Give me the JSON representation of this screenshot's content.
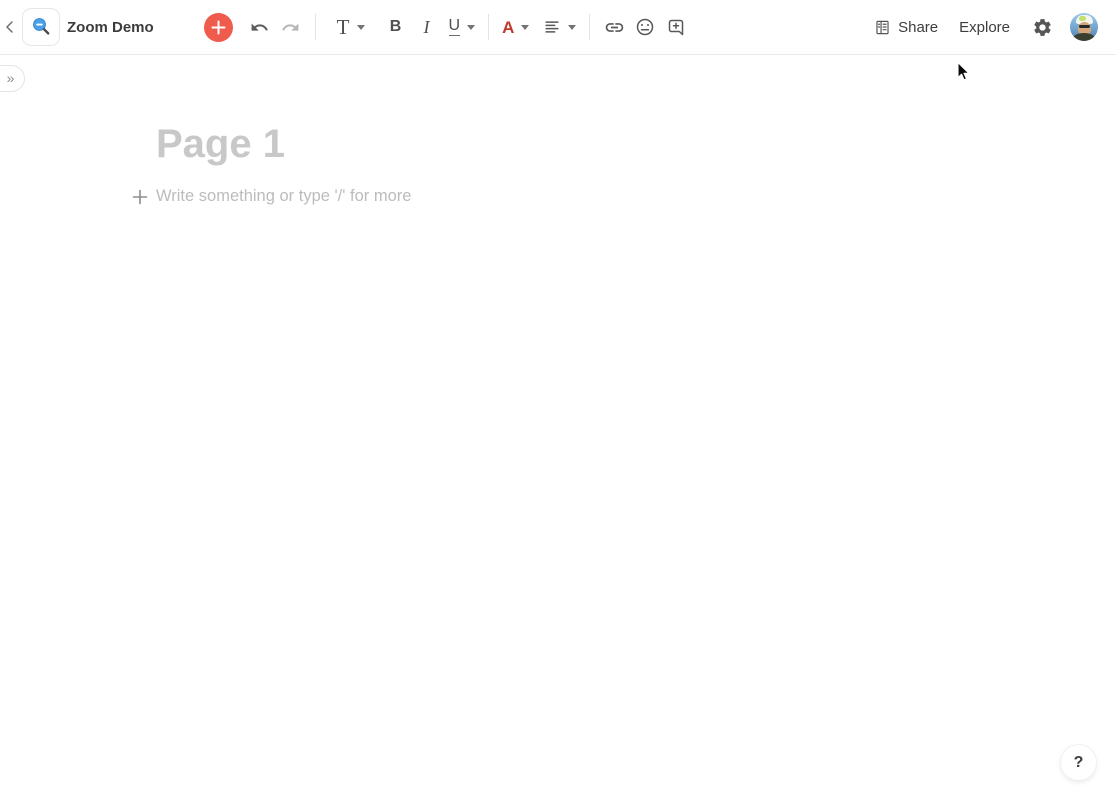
{
  "header": {
    "title": "Zoom Demo",
    "share_label": "Share",
    "explore_label": "Explore"
  },
  "toolbar": {
    "text_style_label": "T",
    "bold_label": "B",
    "italic_label": "I",
    "underline_label": "U",
    "font_color_label": "A"
  },
  "sidebar": {
    "expand_glyph": "»"
  },
  "editor": {
    "page_title_placeholder": "Page 1",
    "body_placeholder": "Write something or type '/' for more"
  },
  "help": {
    "label": "?"
  },
  "icons": {
    "doc_icon": "zoom-out-magnifier",
    "add": "plus-circle",
    "undo": "undo-arrow",
    "redo": "redo-arrow",
    "align": "align-left",
    "link": "chain-link",
    "emoji": "smiley-face",
    "insert": "square-plus-bubble",
    "share": "building",
    "settings": "gear"
  },
  "colors": {
    "accent_red": "#ef5b4c",
    "font_color_swatch": "#c13a2d",
    "lens_blue": "#4aa0e8",
    "placeholder_gray": "#c8c8c8"
  }
}
